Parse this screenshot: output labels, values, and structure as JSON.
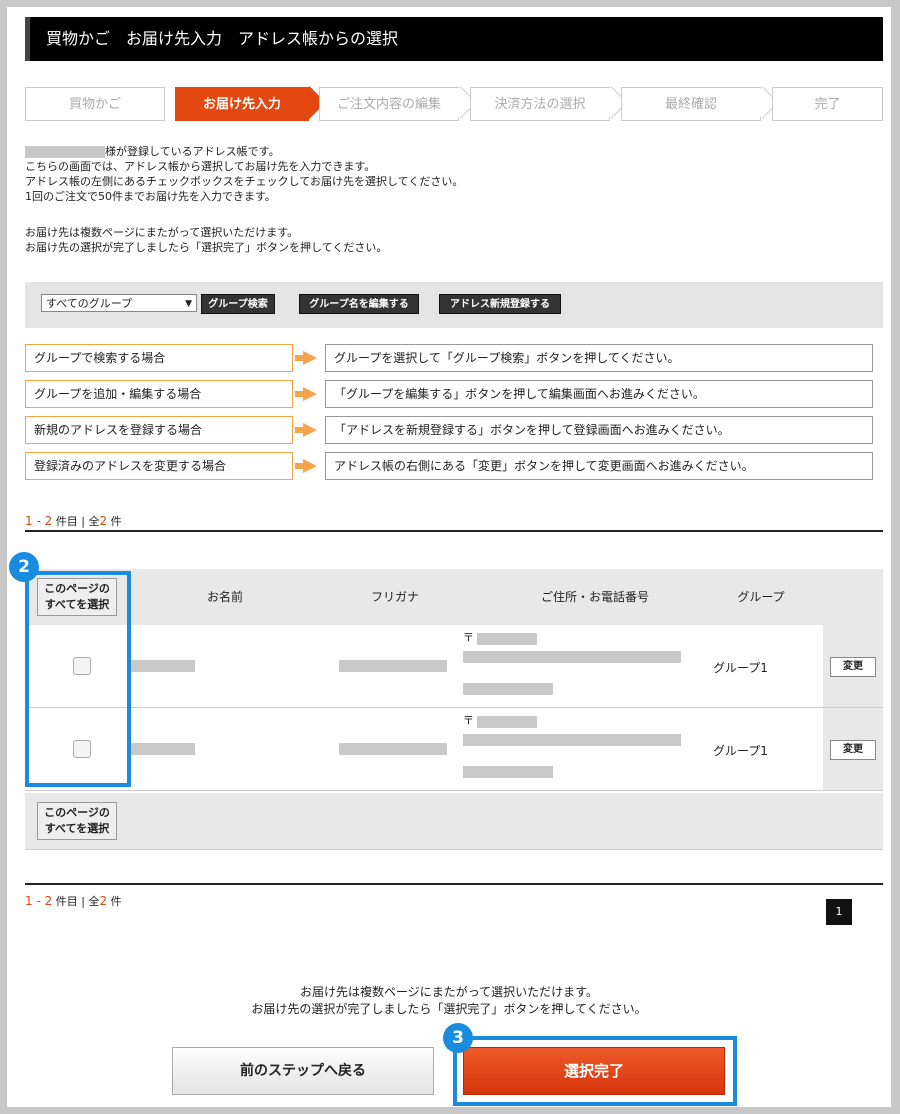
{
  "header": {
    "title": "買物かご　お届け先入力　アドレス帳からの選択"
  },
  "steps": [
    {
      "label": "買物かご",
      "active": false
    },
    {
      "label": "お届け先入力",
      "active": true
    },
    {
      "label": "ご注文内容の編集",
      "active": false
    },
    {
      "label": "決済方法の選択",
      "active": false
    },
    {
      "label": "最終確認",
      "active": false
    },
    {
      "label": "完了",
      "active": false
    }
  ],
  "intro": {
    "line1_suffix": "様が登録しているアドレス帳です。",
    "line2": "こちらの画面では、アドレス帳から選択してお届け先を入力できます。",
    "line3": "アドレス帳の左側にあるチェックボックスをチェックしてお届け先を選択してください。",
    "line4": "1回のご注文で50件までお届け先を入力できます。",
    "line5": "お届け先は複数ページにまたがって選択いただけます。",
    "line6": "お届け先の選択が完了しましたら「選択完了」ボタンを押してください。"
  },
  "toolbar": {
    "group_select_value": "すべてのグループ",
    "group_search_label": "グループ検索",
    "edit_group_label": "グループ名を編集する",
    "new_address_label": "アドレス新規登録する"
  },
  "guides": [
    {
      "case": "グループで検索する場合",
      "action": "グループを選択して「グループ検索」ボタンを押してください。"
    },
    {
      "case": "グループを追加・編集する場合",
      "action": "「グループを編集する」ボタンを押して編集画面へお進みください。"
    },
    {
      "case": "新規のアドレスを登録する場合",
      "action": "「アドレスを新規登録する」ボタンを押して登録画面へお進みください。"
    },
    {
      "case": "登録済みのアドレスを変更する場合",
      "action": "アドレス帳の右側にある「変更」ボタンを押して変更画面へお進みください。"
    }
  ],
  "pagination": {
    "range": "1 - 2",
    "range_suffix": "件目",
    "sep": "|",
    "total_prefix": "全",
    "total": "2",
    "total_suffix": "件",
    "current_page": "1"
  },
  "table": {
    "select_all_line1": "このページの",
    "select_all_line2": "すべてを選択",
    "col_name": "お名前",
    "col_kana": "フリガナ",
    "col_address": "ご住所・お電話番号",
    "col_group": "グループ",
    "rows": [
      {
        "postal_mark": "〒",
        "group": "グループ1",
        "edit_label": "変更",
        "checked": false
      },
      {
        "postal_mark": "〒",
        "group": "グループ1",
        "edit_label": "変更",
        "checked": false
      }
    ]
  },
  "footer": {
    "note1": "お届け先は複数ページにまたがって選択いただけます。",
    "note2": "お届け先の選択が完了しましたら「選択完了」ボタンを押してください。",
    "back_label": "前のステップへ戻る",
    "done_label": "選択完了"
  },
  "annotations": {
    "badge2": "2",
    "badge3": "3"
  },
  "colors": {
    "accent": "#e2480f",
    "guide_orange": "#f4a44a",
    "annotation_blue": "#1a8ce0"
  }
}
